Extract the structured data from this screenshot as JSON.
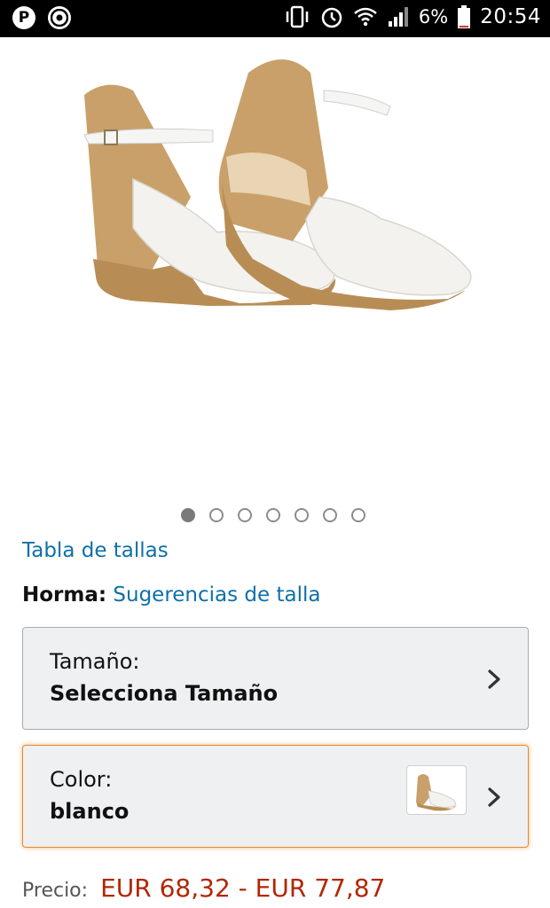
{
  "status_bar": {
    "battery_percent": "6%",
    "time": "20:54",
    "icons": [
      "pinterest-icon",
      "chrome-icon",
      "vibrate-icon",
      "alarm-icon",
      "wifi-icon",
      "signal-icon",
      "battery-icon"
    ]
  },
  "product": {
    "image": "white espadrille wedge sandals",
    "carousel": {
      "count": 7,
      "active_index": 0
    },
    "size_chart_link": "Tabla de tallas",
    "fit_label": "Horma:",
    "fit_link": "Sugerencias de talla"
  },
  "size_selector": {
    "label": "Tamaño:",
    "value": "Selecciona Tamaño"
  },
  "color_selector": {
    "label": "Color:",
    "value": "blanco"
  },
  "price": {
    "label": "Precio:",
    "value": "EUR 68,32 - EUR 77,87"
  },
  "colors": {
    "link": "#0e70a8",
    "price": "#b12704",
    "selected_border": "#e6892f"
  }
}
